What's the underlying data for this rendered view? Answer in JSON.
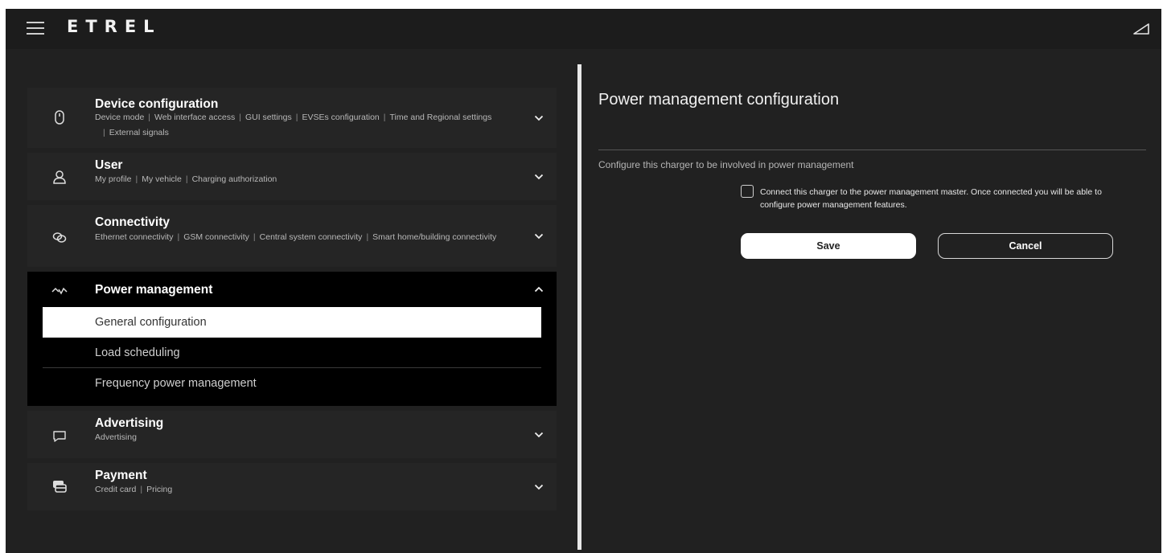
{
  "app": {
    "logo": "ETREL"
  },
  "menu": {
    "device": {
      "title": "Device configuration",
      "subs": [
        "Device mode",
        "Web interface access",
        "GUI settings",
        "EVSEs configuration",
        "Time and Regional settings",
        "External signals"
      ]
    },
    "user": {
      "title": "User",
      "subs": [
        "My profile",
        "My vehicle",
        "Charging authorization"
      ]
    },
    "connectivity": {
      "title": "Connectivity",
      "subs": [
        "Ethernet connectivity",
        "GSM connectivity",
        "Central system connectivity",
        "Smart home/building connectivity"
      ]
    },
    "power": {
      "title": "Power management",
      "items": [
        "General configuration",
        "Load scheduling",
        "Frequency power management"
      ],
      "active_index": 0
    },
    "advertising": {
      "title": "Advertising",
      "subs": [
        "Advertising"
      ]
    },
    "payment": {
      "title": "Payment",
      "subs": [
        "Credit card",
        "Pricing"
      ]
    }
  },
  "panel": {
    "title": "Power management configuration",
    "description": "Configure this charger to be involved in power management",
    "checkbox_label": "Connect this charger to the power management master. Once connected you will be able to configure power management features.",
    "checkbox_checked": false,
    "save_label": "Save",
    "cancel_label": "Cancel"
  },
  "icons": {
    "menu": "hamburger-icon",
    "status": "signal-icon",
    "device": "mouse-icon",
    "user": "user-icon",
    "connectivity": "link-icon",
    "power": "power-wave-icon",
    "advertising": "message-icon",
    "payment": "card-icon",
    "expand": "chevron-down-icon",
    "collapse": "chevron-up-icon"
  },
  "colors": {
    "background": "#212121",
    "topbar": "#1c1c1c",
    "section": "#252525",
    "active_section": "#000000",
    "accent": "#ffffff"
  }
}
